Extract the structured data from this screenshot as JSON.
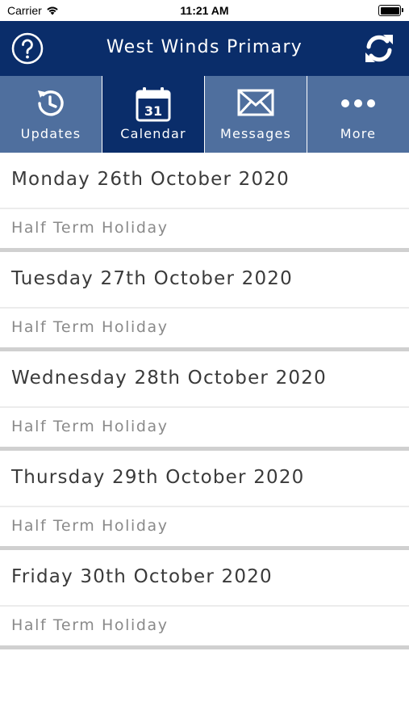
{
  "status_bar": {
    "carrier": "Carrier",
    "time": "11:21 AM"
  },
  "header": {
    "title": "West Winds Primary",
    "help_icon": "question-circle-icon",
    "refresh_icon": "refresh-icon"
  },
  "tabs": [
    {
      "label": "Updates",
      "icon": "history-clock-icon",
      "active": false
    },
    {
      "label": "Calendar",
      "icon": "calendar-icon",
      "calendar_day": "31",
      "active": true
    },
    {
      "label": "Messages",
      "icon": "envelope-icon",
      "active": false
    },
    {
      "label": "More",
      "icon": "more-dots-icon",
      "active": false
    }
  ],
  "days": [
    {
      "date": "Monday 26th October 2020",
      "events": [
        "Half Term Holiday"
      ]
    },
    {
      "date": "Tuesday 27th October 2020",
      "events": [
        "Half Term Holiday"
      ]
    },
    {
      "date": "Wednesday 28th October 2020",
      "events": [
        "Half Term Holiday"
      ]
    },
    {
      "date": "Thursday 29th October 2020",
      "events": [
        "Half Term Holiday"
      ]
    },
    {
      "date": "Friday 30th October 2020",
      "events": [
        "Half Term Holiday"
      ]
    }
  ],
  "colors": {
    "brand_dark": "#0a2d6a",
    "tab_inactive": "#4f6f9e",
    "divider": "#d0d0d0"
  }
}
